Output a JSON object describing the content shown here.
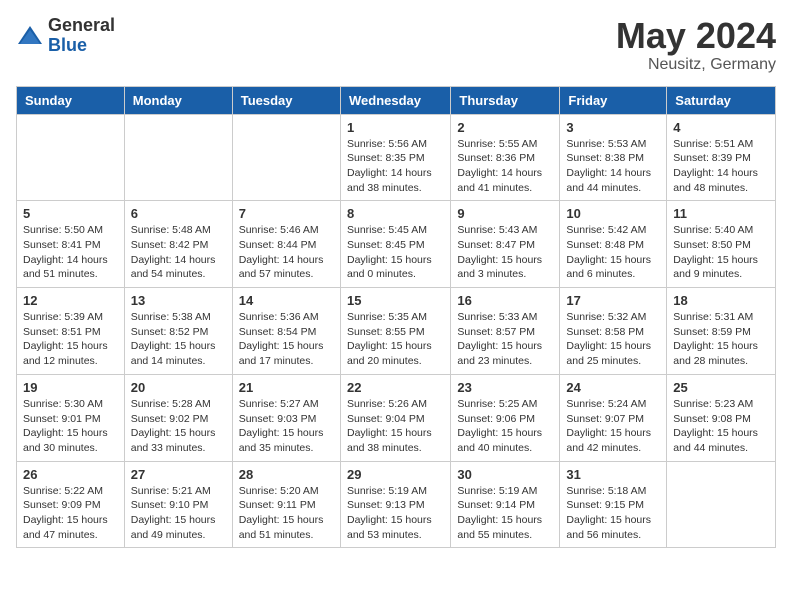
{
  "header": {
    "logo_general": "General",
    "logo_blue": "Blue",
    "month": "May 2024",
    "location": "Neusitz, Germany"
  },
  "days": [
    "Sunday",
    "Monday",
    "Tuesday",
    "Wednesday",
    "Thursday",
    "Friday",
    "Saturday"
  ],
  "weeks": [
    [
      {
        "date": "",
        "info": ""
      },
      {
        "date": "",
        "info": ""
      },
      {
        "date": "",
        "info": ""
      },
      {
        "date": "1",
        "info": "Sunrise: 5:56 AM\nSunset: 8:35 PM\nDaylight: 14 hours\nand 38 minutes."
      },
      {
        "date": "2",
        "info": "Sunrise: 5:55 AM\nSunset: 8:36 PM\nDaylight: 14 hours\nand 41 minutes."
      },
      {
        "date": "3",
        "info": "Sunrise: 5:53 AM\nSunset: 8:38 PM\nDaylight: 14 hours\nand 44 minutes."
      },
      {
        "date": "4",
        "info": "Sunrise: 5:51 AM\nSunset: 8:39 PM\nDaylight: 14 hours\nand 48 minutes."
      }
    ],
    [
      {
        "date": "5",
        "info": "Sunrise: 5:50 AM\nSunset: 8:41 PM\nDaylight: 14 hours\nand 51 minutes."
      },
      {
        "date": "6",
        "info": "Sunrise: 5:48 AM\nSunset: 8:42 PM\nDaylight: 14 hours\nand 54 minutes."
      },
      {
        "date": "7",
        "info": "Sunrise: 5:46 AM\nSunset: 8:44 PM\nDaylight: 14 hours\nand 57 minutes."
      },
      {
        "date": "8",
        "info": "Sunrise: 5:45 AM\nSunset: 8:45 PM\nDaylight: 15 hours\nand 0 minutes."
      },
      {
        "date": "9",
        "info": "Sunrise: 5:43 AM\nSunset: 8:47 PM\nDaylight: 15 hours\nand 3 minutes."
      },
      {
        "date": "10",
        "info": "Sunrise: 5:42 AM\nSunset: 8:48 PM\nDaylight: 15 hours\nand 6 minutes."
      },
      {
        "date": "11",
        "info": "Sunrise: 5:40 AM\nSunset: 8:50 PM\nDaylight: 15 hours\nand 9 minutes."
      }
    ],
    [
      {
        "date": "12",
        "info": "Sunrise: 5:39 AM\nSunset: 8:51 PM\nDaylight: 15 hours\nand 12 minutes."
      },
      {
        "date": "13",
        "info": "Sunrise: 5:38 AM\nSunset: 8:52 PM\nDaylight: 15 hours\nand 14 minutes."
      },
      {
        "date": "14",
        "info": "Sunrise: 5:36 AM\nSunset: 8:54 PM\nDaylight: 15 hours\nand 17 minutes."
      },
      {
        "date": "15",
        "info": "Sunrise: 5:35 AM\nSunset: 8:55 PM\nDaylight: 15 hours\nand 20 minutes."
      },
      {
        "date": "16",
        "info": "Sunrise: 5:33 AM\nSunset: 8:57 PM\nDaylight: 15 hours\nand 23 minutes."
      },
      {
        "date": "17",
        "info": "Sunrise: 5:32 AM\nSunset: 8:58 PM\nDaylight: 15 hours\nand 25 minutes."
      },
      {
        "date": "18",
        "info": "Sunrise: 5:31 AM\nSunset: 8:59 PM\nDaylight: 15 hours\nand 28 minutes."
      }
    ],
    [
      {
        "date": "19",
        "info": "Sunrise: 5:30 AM\nSunset: 9:01 PM\nDaylight: 15 hours\nand 30 minutes."
      },
      {
        "date": "20",
        "info": "Sunrise: 5:28 AM\nSunset: 9:02 PM\nDaylight: 15 hours\nand 33 minutes."
      },
      {
        "date": "21",
        "info": "Sunrise: 5:27 AM\nSunset: 9:03 PM\nDaylight: 15 hours\nand 35 minutes."
      },
      {
        "date": "22",
        "info": "Sunrise: 5:26 AM\nSunset: 9:04 PM\nDaylight: 15 hours\nand 38 minutes."
      },
      {
        "date": "23",
        "info": "Sunrise: 5:25 AM\nSunset: 9:06 PM\nDaylight: 15 hours\nand 40 minutes."
      },
      {
        "date": "24",
        "info": "Sunrise: 5:24 AM\nSunset: 9:07 PM\nDaylight: 15 hours\nand 42 minutes."
      },
      {
        "date": "25",
        "info": "Sunrise: 5:23 AM\nSunset: 9:08 PM\nDaylight: 15 hours\nand 44 minutes."
      }
    ],
    [
      {
        "date": "26",
        "info": "Sunrise: 5:22 AM\nSunset: 9:09 PM\nDaylight: 15 hours\nand 47 minutes."
      },
      {
        "date": "27",
        "info": "Sunrise: 5:21 AM\nSunset: 9:10 PM\nDaylight: 15 hours\nand 49 minutes."
      },
      {
        "date": "28",
        "info": "Sunrise: 5:20 AM\nSunset: 9:11 PM\nDaylight: 15 hours\nand 51 minutes."
      },
      {
        "date": "29",
        "info": "Sunrise: 5:19 AM\nSunset: 9:13 PM\nDaylight: 15 hours\nand 53 minutes."
      },
      {
        "date": "30",
        "info": "Sunrise: 5:19 AM\nSunset: 9:14 PM\nDaylight: 15 hours\nand 55 minutes."
      },
      {
        "date": "31",
        "info": "Sunrise: 5:18 AM\nSunset: 9:15 PM\nDaylight: 15 hours\nand 56 minutes."
      },
      {
        "date": "",
        "info": ""
      }
    ]
  ]
}
